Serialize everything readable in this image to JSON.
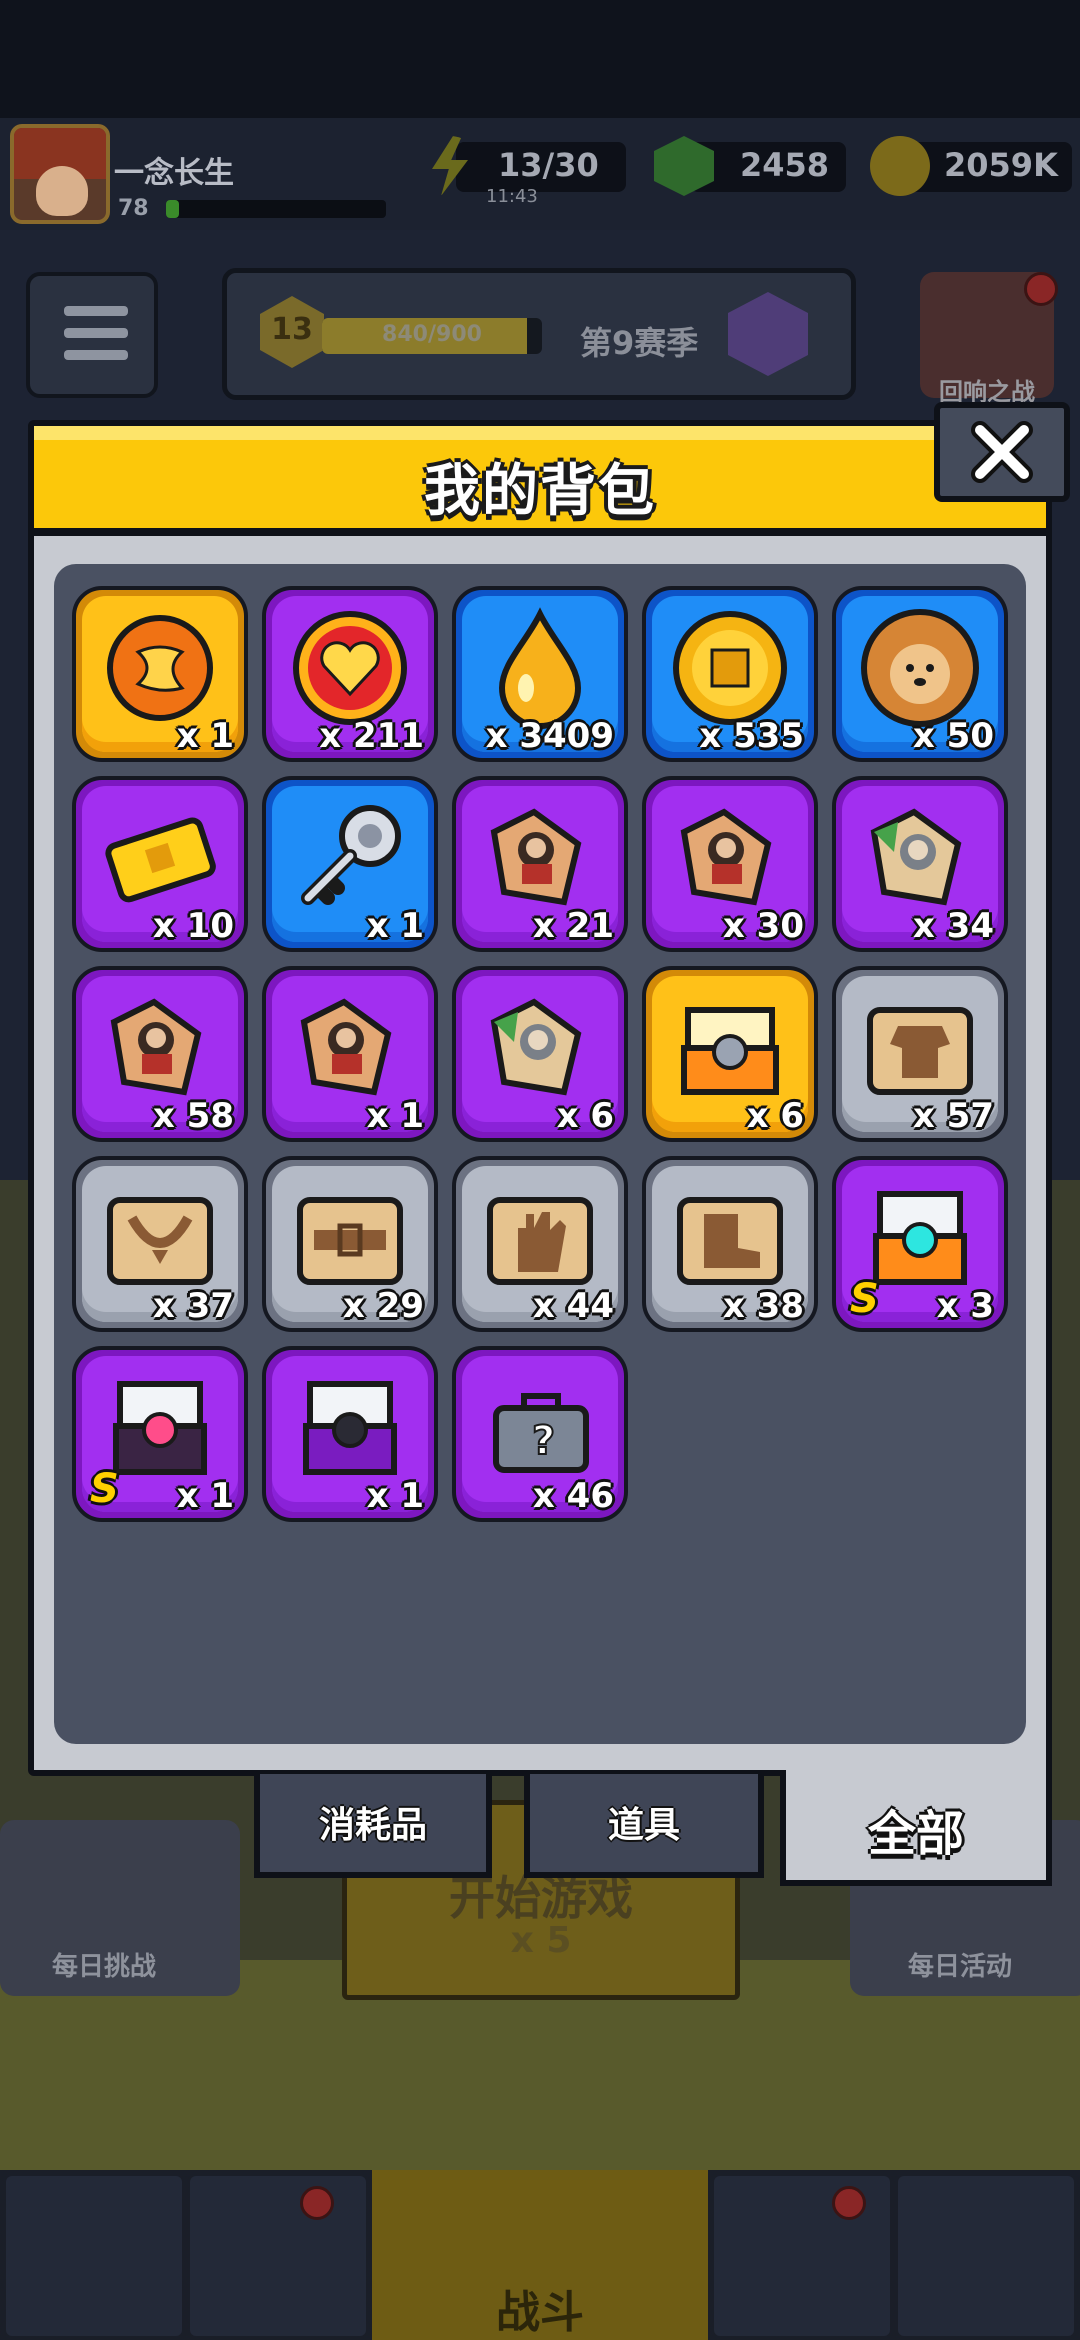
{
  "topbar": {
    "username": "一念长生",
    "level": "78",
    "energy": "13/30",
    "energy_timer": "11:43",
    "gems": "2458",
    "coins": "2059K"
  },
  "season": {
    "level": "13",
    "progress_text": "840/900",
    "progress": 0.933,
    "name": "第9赛季"
  },
  "event": {
    "label": "回响之战"
  },
  "scene": {
    "daily_challenge": "每日挑战",
    "daily_activity": "每日活动",
    "start_game": "开始游戏",
    "start_cost": "x 5"
  },
  "nav": {
    "battle_label": "战斗"
  },
  "backpack": {
    "title": "我的背包",
    "items": [
      {
        "icon": "orange-orb-icon",
        "rarity": "gold",
        "qty": "x 1"
      },
      {
        "icon": "heart-medal-icon",
        "rarity": "purple",
        "qty": "x 211"
      },
      {
        "icon": "golden-droplet-icon",
        "rarity": "blue",
        "qty": "x 3409"
      },
      {
        "icon": "gold-coin-icon",
        "rarity": "blue",
        "qty": "x 535"
      },
      {
        "icon": "dog-cookie-icon",
        "rarity": "blue",
        "qty": "x 50"
      },
      {
        "icon": "gold-ticket-icon",
        "rarity": "purple",
        "qty": "x 10"
      },
      {
        "icon": "silver-key-icon",
        "rarity": "blue",
        "qty": "x 1"
      },
      {
        "icon": "puzzle-piece-icon",
        "rarity": "purple",
        "qty": "x 21"
      },
      {
        "icon": "puzzle-piece-icon",
        "rarity": "purple",
        "qty": "x 30"
      },
      {
        "icon": "puzzle-piece-green-icon",
        "rarity": "purple",
        "qty": "x 34"
      },
      {
        "icon": "puzzle-piece-icon",
        "rarity": "purple",
        "qty": "x 58"
      },
      {
        "icon": "puzzle-piece-icon",
        "rarity": "purple",
        "qty": "x 1"
      },
      {
        "icon": "puzzle-piece-green-icon",
        "rarity": "purple",
        "qty": "x 6"
      },
      {
        "icon": "gold-chest-icon",
        "rarity": "gold",
        "qty": "x 6"
      },
      {
        "icon": "scroll-armor-icon",
        "rarity": "gray",
        "qty": "x 57"
      },
      {
        "icon": "scroll-necklace-icon",
        "rarity": "gray",
        "qty": "x 37"
      },
      {
        "icon": "scroll-belt-icon",
        "rarity": "gray",
        "qty": "x 29"
      },
      {
        "icon": "scroll-glove-icon",
        "rarity": "gray",
        "qty": "x 44"
      },
      {
        "icon": "scroll-boots-icon",
        "rarity": "gray",
        "qty": "x 38"
      },
      {
        "icon": "s-chest-orange-icon",
        "rarity": "purple",
        "qty": "x 3",
        "badge": "S"
      },
      {
        "icon": "s-chest-dark-icon",
        "rarity": "purple",
        "qty": "x 1",
        "badge": "S"
      },
      {
        "icon": "purple-chest-icon",
        "rarity": "purple",
        "qty": "x 1"
      },
      {
        "icon": "mystery-box-icon",
        "rarity": "purple",
        "qty": "x 46"
      }
    ],
    "tabs": {
      "consumables": "消耗品",
      "props": "道具",
      "all": "全部"
    }
  },
  "colors": {
    "header_yellow": "#fcc80a",
    "rarity_gold": "#ffc118",
    "rarity_purple": "#a22ff0",
    "rarity_blue": "#1f8df7",
    "rarity_gray": "#b4bac6"
  }
}
